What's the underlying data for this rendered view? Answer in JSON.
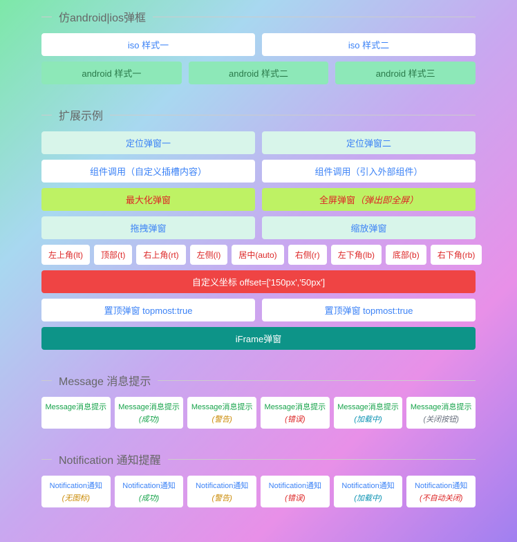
{
  "sections": {
    "mobile": {
      "title": "仿android|ios弹框",
      "row1": [
        "iso 样式一",
        "iso 样式二"
      ],
      "row2": [
        "android 样式一",
        "android 样式二",
        "android 样式三"
      ]
    },
    "ext": {
      "title": "扩展示例",
      "r1": [
        "定位弹窗一",
        "定位弹窗二"
      ],
      "r2": [
        "组件调用（自定义插槽内容）",
        "组件调用（引入外部组件）"
      ],
      "r3a": "最大化弹窗",
      "r3b_pre": "全屏弹窗",
      "r3b_suf": "（弹出即全屏）",
      "r4": [
        "拖拽弹窗",
        "缩放弹窗"
      ],
      "r5": [
        "左上角(lt)",
        "顶部(t)",
        "右上角(rt)",
        "左侧(l)",
        "居中(auto)",
        "右侧(r)",
        "左下角(lb)",
        "底部(b)",
        "右下角(rb)"
      ],
      "r6": "自定义坐标 offset=['150px','50px']",
      "r7": [
        "置顶弹窗 topmost:true",
        "置顶弹窗 topmost:true"
      ],
      "r8": "iFrame弹窗"
    },
    "msg": {
      "title": "Message 消息提示",
      "label": "Message消息提示",
      "subs": [
        "",
        "成功",
        "警告",
        "错误",
        "加载中",
        "关闭按钮"
      ]
    },
    "notif": {
      "title": "Notification 通知提醒",
      "label": "Notification通知",
      "subs": [
        "无图标",
        "成功",
        "警告",
        "错误",
        "加载中",
        "不自动关闭"
      ]
    }
  }
}
